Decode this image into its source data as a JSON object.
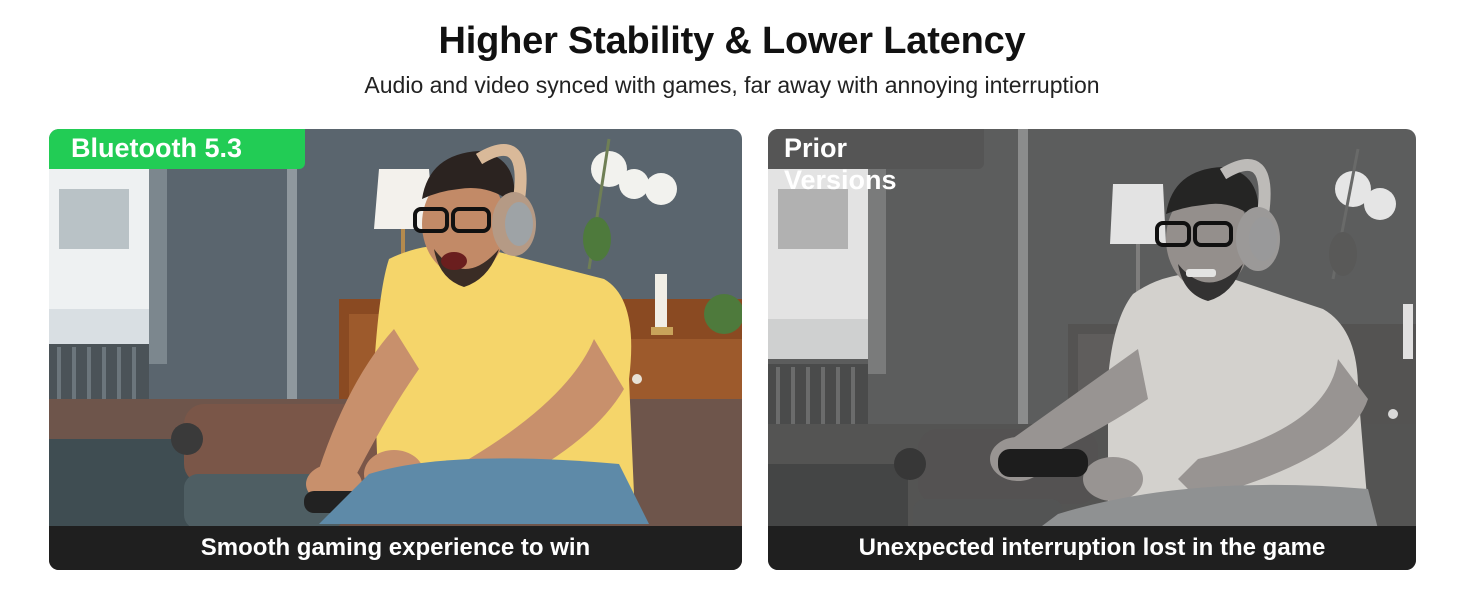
{
  "header": {
    "title": "Higher Stability & Lower Latency",
    "subtitle": "Audio and video synced with games, far away with annoying interruption"
  },
  "comparison": {
    "left": {
      "badge": "Bluetooth 5.3",
      "caption": "Smooth gaming experience to win",
      "badge_color": "#22cc55"
    },
    "right": {
      "badge": "Prior Versions",
      "caption": "Unexpected interruption lost in the game",
      "badge_color": "#555555"
    }
  },
  "colors": {
    "caption_bar": "#1f1f1f",
    "shirt_left": "#f5d56a",
    "shirt_right": "#e8dcc0",
    "wall": "#56616b"
  }
}
